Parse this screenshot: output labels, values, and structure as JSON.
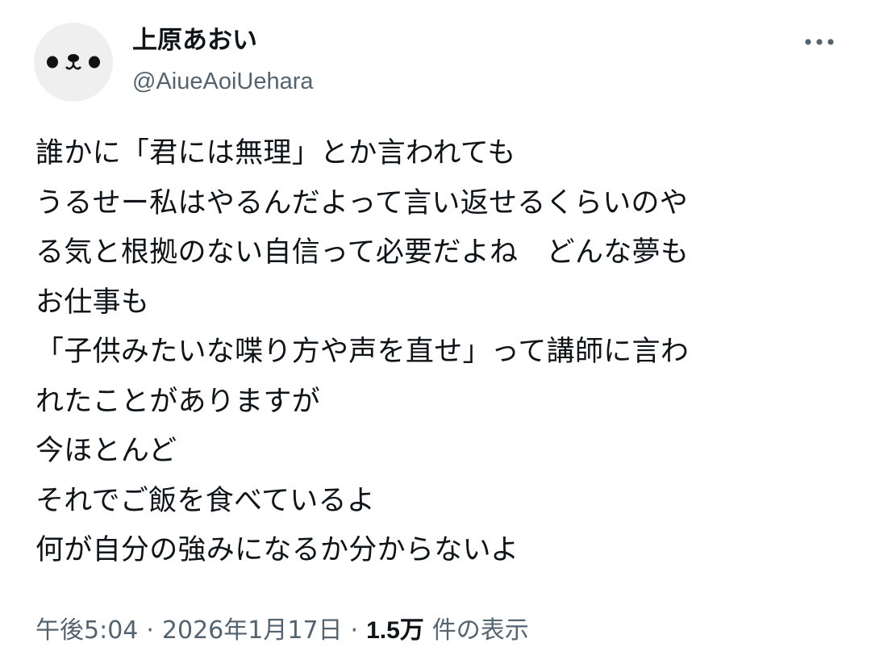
{
  "author": {
    "display_name": "上原あおい",
    "handle": "@AiueAoiUehara",
    "avatar_icon": "panda-face-icon"
  },
  "more_icon": "more-options-icon",
  "tweet": {
    "lines": [
      "誰かに「君には無理」とか言われても",
      "うるせー私はやるんだよって言い返せるくらいのや",
      "る気と根拠のない自信って必要だよね　どんな夢も",
      "お仕事も",
      "「子供みたいな喋り方や声を直せ」って講師に言わ",
      "れたことがありますが",
      "今ほとんど",
      "それでご飯を食べているよ",
      "何が自分の強みになるか分からないよ"
    ]
  },
  "meta": {
    "time": "午後5:04",
    "date": "2026年1月17日",
    "separator": "·",
    "views_count": "1.5万",
    "views_label": "件の表示"
  },
  "colors": {
    "text": "#0f1419",
    "secondary": "#536471",
    "avatar_bg": "#efefef"
  }
}
